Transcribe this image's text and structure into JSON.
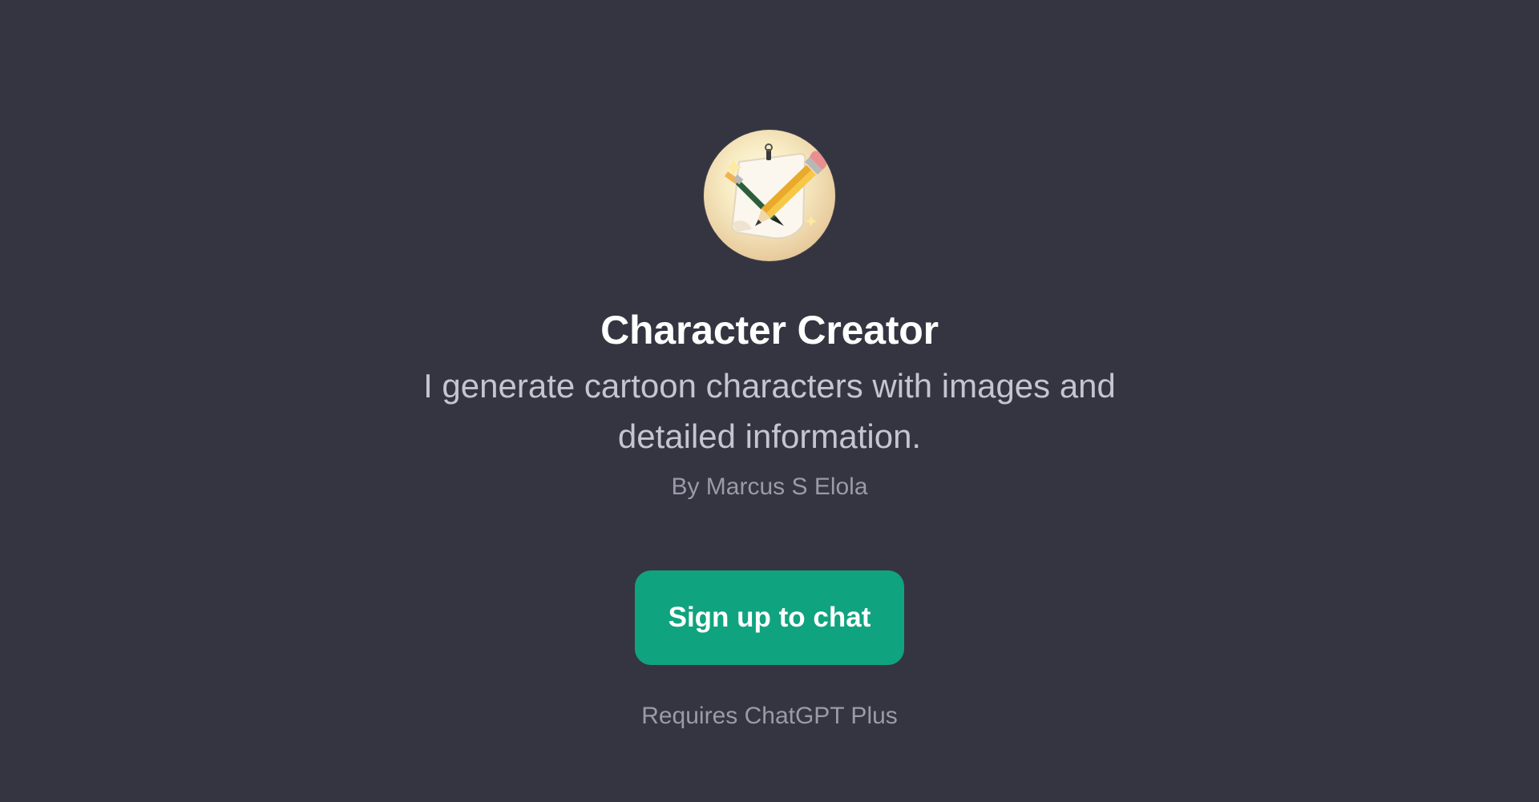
{
  "gpt": {
    "avatar_icon": "pencil-and-paper-icon",
    "name": "Character Creator",
    "description": "I generate cartoon characters with images and detailed information.",
    "author": "By Marcus S Elola"
  },
  "cta": {
    "label": "Sign up to chat"
  },
  "requirement": "Requires ChatGPT Plus",
  "colors": {
    "background": "#343541",
    "accent": "#10a37f",
    "title": "#ffffff",
    "description": "#c5c5d2",
    "muted": "#9a9aa8"
  }
}
